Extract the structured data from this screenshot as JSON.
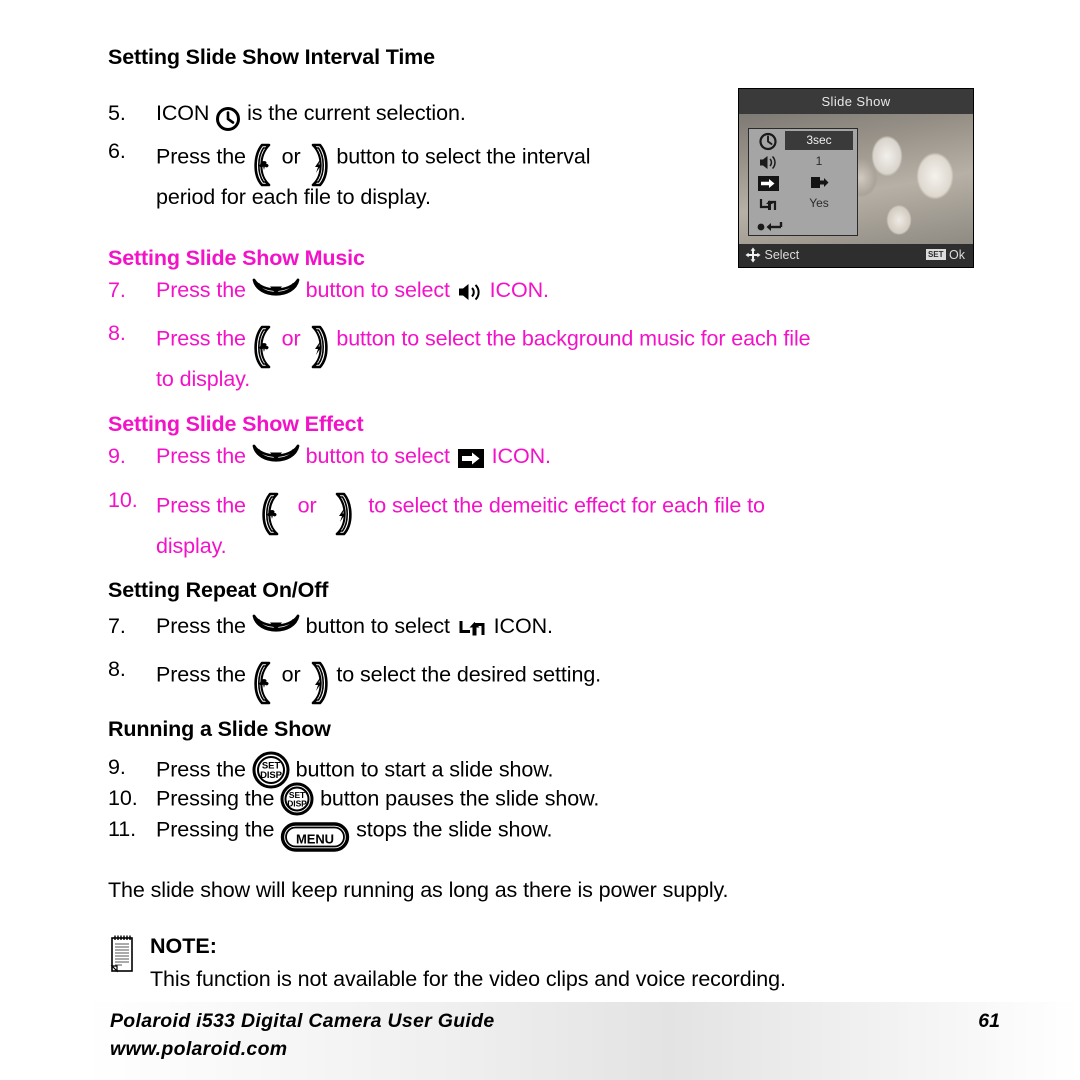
{
  "document": {
    "title": "Polaroid i533 Digital Camera User Guide",
    "page_number": "61",
    "website": "www.polaroid.com"
  },
  "colors": {
    "magenta": "#F312C8",
    "black": "#000000",
    "lcd_title_bg": "#3A3A3A",
    "lcd_bg": "#9A9A9A"
  },
  "sections": [
    {
      "heading": "Setting Slide Show Interval Time",
      "heading_color": "black",
      "steps": [
        {
          "num": "5.",
          "parts": [
            "ICON ",
            "clock-icon",
            " is the current selection."
          ],
          "lines": [
            "ICON  is the current selection."
          ]
        },
        {
          "num": "6.",
          "lines": [
            "Press the  or  button to select the interval",
            "period for each file to display."
          ]
        }
      ]
    },
    {
      "heading": "Setting Slide Show Music",
      "heading_color": "magenta",
      "steps": [
        {
          "num": "7.",
          "lines": [
            "Press the  button to select  ICON."
          ]
        },
        {
          "num": "8.",
          "lines": [
            "Press the  or  button to select the background music for each file",
            "to display."
          ]
        }
      ]
    },
    {
      "heading": "Setting Slide Show Effect",
      "heading_color": "magenta",
      "steps": [
        {
          "num": "9.",
          "lines": [
            "Press the  button to select  ICON."
          ]
        },
        {
          "num": "10.",
          "lines": [
            "Press the  or  to select the demeitic effect for each file to",
            "display."
          ]
        }
      ]
    },
    {
      "heading": "Setting Repeat On/Off",
      "heading_color": "black",
      "steps": [
        {
          "num": "7.",
          "lines": [
            "Press the  button to select  ICON."
          ]
        },
        {
          "num": "8.",
          "lines": [
            "Press the  or  to select the desired setting."
          ]
        }
      ]
    },
    {
      "heading": "Running a Slide Show",
      "heading_color": "black",
      "steps": [
        {
          "num": "9.",
          "lines": [
            "Press the  button to start a slide show."
          ]
        },
        {
          "num": "10.",
          "lines": [
            "Pressing the  button pauses the slide show."
          ]
        },
        {
          "num": "11.",
          "lines": [
            "Pressing the  stops the slide show."
          ]
        }
      ]
    }
  ],
  "text": {
    "s1_heading": "Setting Slide Show Interval Time",
    "s1_step5_num": "5.",
    "s1_step5_a": "ICON",
    "s1_step5_b": "is the current selection.",
    "s1_step6_num": "6.",
    "s1_step6_a": "Press the",
    "s1_step6_or": "or",
    "s1_step6_b": "button to select the interval",
    "s1_step6_c": "period for each file to display.",
    "s2_heading": "Setting Slide Show Music",
    "s2_step7_num": "7.",
    "s2_step7_a": "Press the",
    "s2_step7_b": "button to select",
    "s2_step7_c": "ICON.",
    "s2_step8_num": "8.",
    "s2_step8_a": "Press the",
    "s2_step8_or": "or",
    "s2_step8_b": "button to select the background music for each file",
    "s2_step8_c": "to display.",
    "s3_heading": "Setting Slide Show Effect",
    "s3_step9_num": "9.",
    "s3_step9_a": "Press the",
    "s3_step9_b": "button to select",
    "s3_step9_c": "ICON.",
    "s3_step10_num": "10.",
    "s3_step10_a": "Press  the",
    "s3_step10_or": "or",
    "s3_step10_b": "to  select  the  demeitic  effect  for  each  file  to",
    "s3_step10_c": "display.",
    "s4_heading": "Setting Repeat On/Off",
    "s4_step7_num": "7.",
    "s4_step7_a": "Press the",
    "s4_step7_b": "button to select",
    "s4_step7_c": "ICON.",
    "s4_step8_num": "8.",
    "s4_step8_a": "Press the",
    "s4_step8_or": "or",
    "s4_step8_b": "to select the desired setting.",
    "s5_heading": "Running a Slide Show",
    "s5_step9_num": "9.",
    "s5_step9_a": "Press the",
    "s5_step9_b": "button to start a slide show.",
    "s5_step10_num": "10.",
    "s5_step10_a": "Pressing the",
    "s5_step10_b": "button pauses the slide show.",
    "s5_step11_num": "11.",
    "s5_step11_a": "Pressing the",
    "s5_step11_b": "stops the slide show.",
    "closing": "The slide show will keep running as long as there is power supply.",
    "note_label": "NOTE:",
    "note_text": "This function is not available for the video clips and voice recording."
  },
  "lcd": {
    "title": "Slide Show",
    "rows": [
      {
        "icon": "clock-icon",
        "value": "3sec",
        "highlighted": true
      },
      {
        "icon": "speaker-icon",
        "value": "1",
        "highlighted": false
      },
      {
        "icon": "effect-icon",
        "value": "",
        "highlighted": false
      },
      {
        "icon": "repeat-icon",
        "value": "Yes",
        "highlighted": false
      },
      {
        "icon": "exit-icon",
        "value": "",
        "highlighted": false
      }
    ],
    "bottom_left": "Select",
    "bottom_right": "Ok",
    "set_badge": "SET"
  },
  "buttons": {
    "set_disp_line1": "SET",
    "set_disp_line2": "DISP",
    "menu": "MENU"
  }
}
